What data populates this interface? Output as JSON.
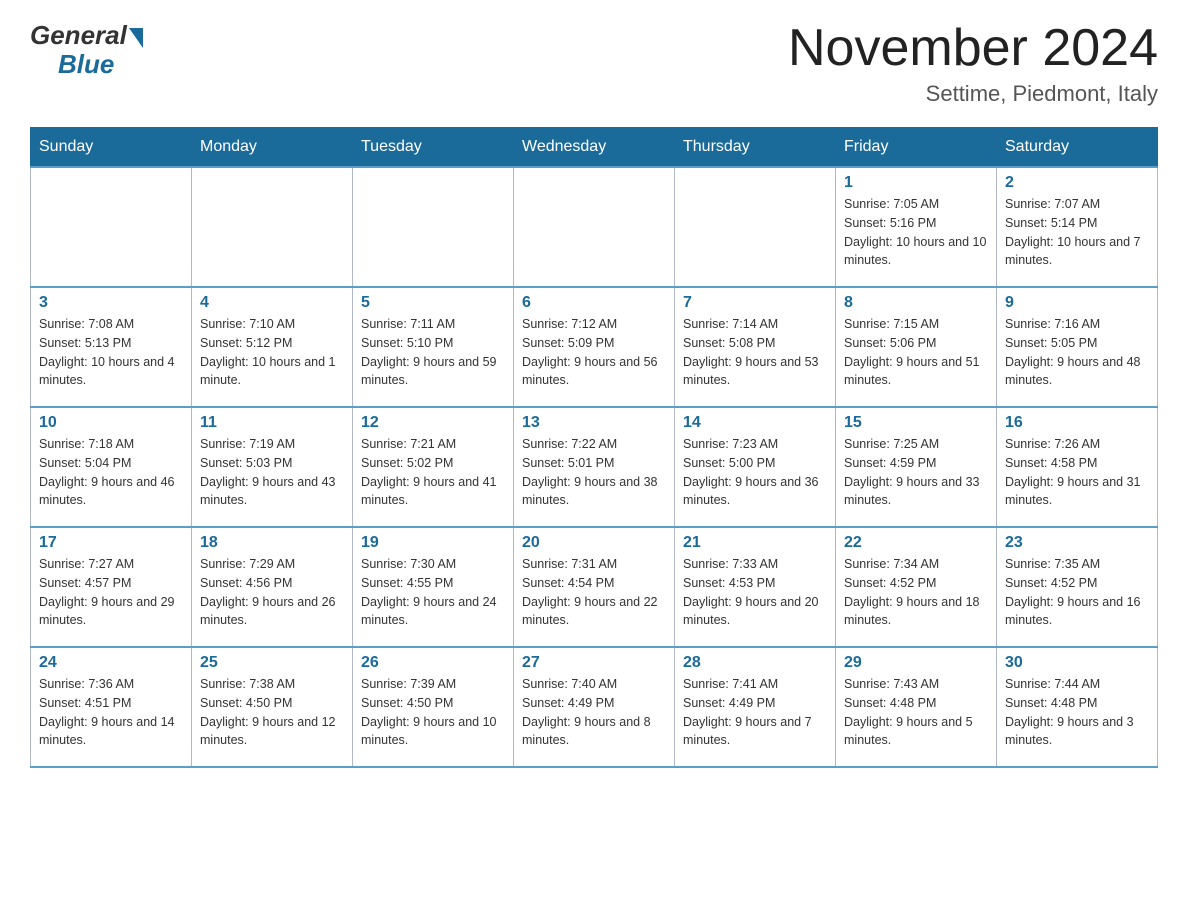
{
  "header": {
    "logo_general": "General",
    "logo_blue": "Blue",
    "title": "November 2024",
    "subtitle": "Settime, Piedmont, Italy"
  },
  "days_of_week": [
    "Sunday",
    "Monday",
    "Tuesday",
    "Wednesday",
    "Thursday",
    "Friday",
    "Saturday"
  ],
  "weeks": [
    [
      {
        "day": "",
        "info": ""
      },
      {
        "day": "",
        "info": ""
      },
      {
        "day": "",
        "info": ""
      },
      {
        "day": "",
        "info": ""
      },
      {
        "day": "",
        "info": ""
      },
      {
        "day": "1",
        "info": "Sunrise: 7:05 AM\nSunset: 5:16 PM\nDaylight: 10 hours and 10 minutes."
      },
      {
        "day": "2",
        "info": "Sunrise: 7:07 AM\nSunset: 5:14 PM\nDaylight: 10 hours and 7 minutes."
      }
    ],
    [
      {
        "day": "3",
        "info": "Sunrise: 7:08 AM\nSunset: 5:13 PM\nDaylight: 10 hours and 4 minutes."
      },
      {
        "day": "4",
        "info": "Sunrise: 7:10 AM\nSunset: 5:12 PM\nDaylight: 10 hours and 1 minute."
      },
      {
        "day": "5",
        "info": "Sunrise: 7:11 AM\nSunset: 5:10 PM\nDaylight: 9 hours and 59 minutes."
      },
      {
        "day": "6",
        "info": "Sunrise: 7:12 AM\nSunset: 5:09 PM\nDaylight: 9 hours and 56 minutes."
      },
      {
        "day": "7",
        "info": "Sunrise: 7:14 AM\nSunset: 5:08 PM\nDaylight: 9 hours and 53 minutes."
      },
      {
        "day": "8",
        "info": "Sunrise: 7:15 AM\nSunset: 5:06 PM\nDaylight: 9 hours and 51 minutes."
      },
      {
        "day": "9",
        "info": "Sunrise: 7:16 AM\nSunset: 5:05 PM\nDaylight: 9 hours and 48 minutes."
      }
    ],
    [
      {
        "day": "10",
        "info": "Sunrise: 7:18 AM\nSunset: 5:04 PM\nDaylight: 9 hours and 46 minutes."
      },
      {
        "day": "11",
        "info": "Sunrise: 7:19 AM\nSunset: 5:03 PM\nDaylight: 9 hours and 43 minutes."
      },
      {
        "day": "12",
        "info": "Sunrise: 7:21 AM\nSunset: 5:02 PM\nDaylight: 9 hours and 41 minutes."
      },
      {
        "day": "13",
        "info": "Sunrise: 7:22 AM\nSunset: 5:01 PM\nDaylight: 9 hours and 38 minutes."
      },
      {
        "day": "14",
        "info": "Sunrise: 7:23 AM\nSunset: 5:00 PM\nDaylight: 9 hours and 36 minutes."
      },
      {
        "day": "15",
        "info": "Sunrise: 7:25 AM\nSunset: 4:59 PM\nDaylight: 9 hours and 33 minutes."
      },
      {
        "day": "16",
        "info": "Sunrise: 7:26 AM\nSunset: 4:58 PM\nDaylight: 9 hours and 31 minutes."
      }
    ],
    [
      {
        "day": "17",
        "info": "Sunrise: 7:27 AM\nSunset: 4:57 PM\nDaylight: 9 hours and 29 minutes."
      },
      {
        "day": "18",
        "info": "Sunrise: 7:29 AM\nSunset: 4:56 PM\nDaylight: 9 hours and 26 minutes."
      },
      {
        "day": "19",
        "info": "Sunrise: 7:30 AM\nSunset: 4:55 PM\nDaylight: 9 hours and 24 minutes."
      },
      {
        "day": "20",
        "info": "Sunrise: 7:31 AM\nSunset: 4:54 PM\nDaylight: 9 hours and 22 minutes."
      },
      {
        "day": "21",
        "info": "Sunrise: 7:33 AM\nSunset: 4:53 PM\nDaylight: 9 hours and 20 minutes."
      },
      {
        "day": "22",
        "info": "Sunrise: 7:34 AM\nSunset: 4:52 PM\nDaylight: 9 hours and 18 minutes."
      },
      {
        "day": "23",
        "info": "Sunrise: 7:35 AM\nSunset: 4:52 PM\nDaylight: 9 hours and 16 minutes."
      }
    ],
    [
      {
        "day": "24",
        "info": "Sunrise: 7:36 AM\nSunset: 4:51 PM\nDaylight: 9 hours and 14 minutes."
      },
      {
        "day": "25",
        "info": "Sunrise: 7:38 AM\nSunset: 4:50 PM\nDaylight: 9 hours and 12 minutes."
      },
      {
        "day": "26",
        "info": "Sunrise: 7:39 AM\nSunset: 4:50 PM\nDaylight: 9 hours and 10 minutes."
      },
      {
        "day": "27",
        "info": "Sunrise: 7:40 AM\nSunset: 4:49 PM\nDaylight: 9 hours and 8 minutes."
      },
      {
        "day": "28",
        "info": "Sunrise: 7:41 AM\nSunset: 4:49 PM\nDaylight: 9 hours and 7 minutes."
      },
      {
        "day": "29",
        "info": "Sunrise: 7:43 AM\nSunset: 4:48 PM\nDaylight: 9 hours and 5 minutes."
      },
      {
        "day": "30",
        "info": "Sunrise: 7:44 AM\nSunset: 4:48 PM\nDaylight: 9 hours and 3 minutes."
      }
    ]
  ]
}
